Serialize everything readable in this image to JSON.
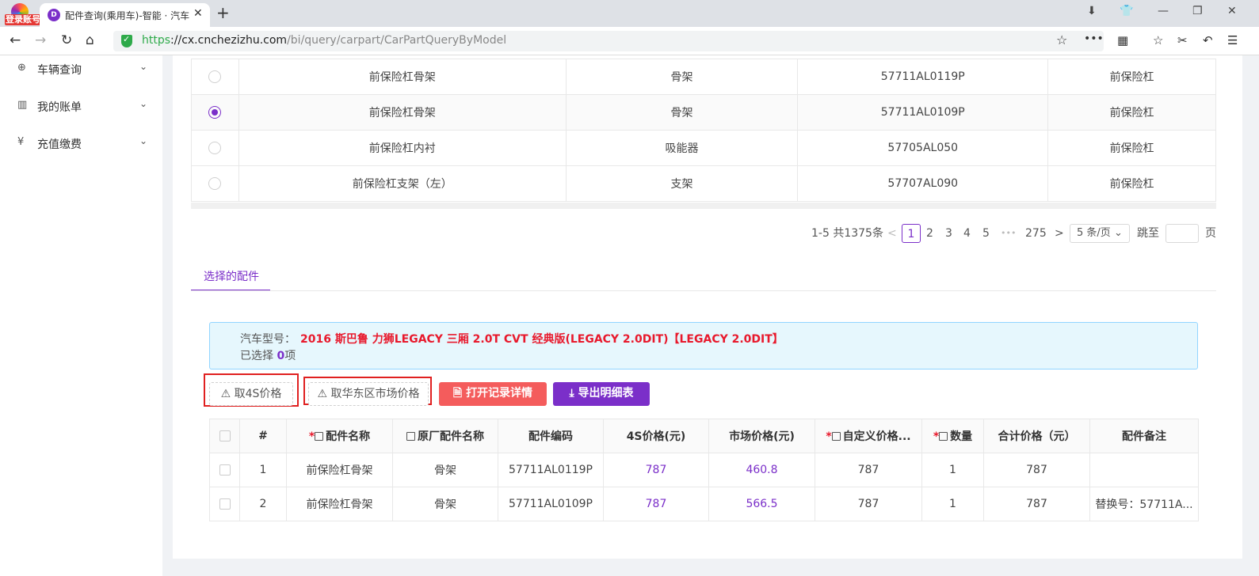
{
  "browser": {
    "login_badge": "登录账号",
    "tab_title": "配件查询(乘用车)-智能 · 汽车",
    "url_https": "https",
    "url_host": "://cx.cnchezizhu.com",
    "url_path": "/bi/query/carpart/CarPartQueryByModel"
  },
  "sidebar": {
    "items": [
      {
        "label": "车辆查询",
        "icon": "search-icon"
      },
      {
        "label": "我的账单",
        "icon": "bar-chart-icon"
      },
      {
        "label": "充值缴费",
        "icon": "yen-shield-icon"
      }
    ]
  },
  "top_table": {
    "rows": [
      {
        "name": "前保险杠骨架",
        "category": "骨架",
        "code": "57711AL0119P",
        "group": "前保险杠",
        "selected": false
      },
      {
        "name": "前保险杠骨架",
        "category": "骨架",
        "code": "57711AL0109P",
        "group": "前保险杠",
        "selected": true
      },
      {
        "name": "前保险杠内衬",
        "category": "吸能器",
        "code": "57705AL050",
        "group": "前保险杠",
        "selected": false
      },
      {
        "name": "前保险杠支架（左）",
        "category": "支架",
        "code": "57707AL090",
        "group": "前保险杠",
        "selected": false
      }
    ]
  },
  "pagination": {
    "summary": "1-5 共1375条",
    "prev": "<",
    "pages": [
      "1",
      "2",
      "3",
      "4",
      "5"
    ],
    "ellipsis": "•••",
    "last": "275",
    "next": ">",
    "page_size": "5 条/页",
    "jump_label": "跳至",
    "jump_suffix": "页"
  },
  "section_tab": "选择的配件",
  "info": {
    "model_label": "汽车型号：",
    "model_value": "2016 斯巴鲁 力狮LEGACY 三厢 2.0T CVT 经典版(LEGACY 2.0DIT)【LEGACY 2.0DIT】",
    "selected_prefix": "已选择 ",
    "selected_count": "0",
    "selected_suffix": "项"
  },
  "actions": {
    "get_4s": "取4S价格",
    "get_east_china": "取华东区市场价格",
    "open_records": "打开记录详情",
    "export": "导出明细表"
  },
  "bottom_table": {
    "headers": {
      "index": "#",
      "part_name": "配件名称",
      "oem_name": "原厂配件名称",
      "code": "配件编码",
      "price_4s": "4S价格(元)",
      "market_price": "市场价格(元)",
      "custom_price": "自定义价格...",
      "qty": "数量",
      "total": "合计价格（元）",
      "note": "配件备注"
    },
    "rows": [
      {
        "index": "1",
        "part_name": "前保险杠骨架",
        "oem_name": "骨架",
        "code": "57711AL0119P",
        "price_4s": "787",
        "market_price": "460.8",
        "custom_price": "787",
        "qty": "1",
        "total": "787",
        "note": ""
      },
      {
        "index": "2",
        "part_name": "前保险杠骨架",
        "oem_name": "骨架",
        "code": "57711AL0109P",
        "price_4s": "787",
        "market_price": "566.5",
        "custom_price": "787",
        "qty": "1",
        "total": "787",
        "note": "替换号：57711A..."
      }
    ]
  }
}
